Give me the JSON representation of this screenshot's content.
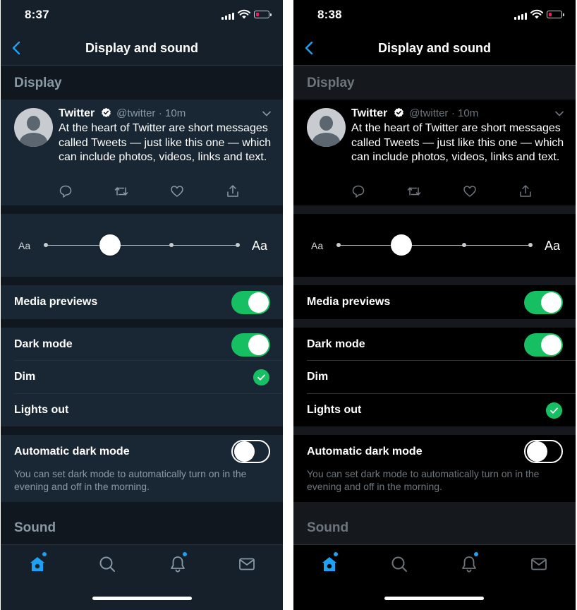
{
  "colors": {
    "accent": "#1da1f2",
    "toggle_on": "#17bf63",
    "dim_background": "#15202b",
    "lights_out_background": "#000000"
  },
  "screens": [
    {
      "theme": "dim",
      "status": {
        "time": "8:37"
      },
      "nav": {
        "title": "Display and sound",
        "back_icon": "chevron-left-icon"
      },
      "display_header": "Display",
      "tweet": {
        "name": "Twitter",
        "handle": "@twitter",
        "time": "· 10m",
        "text": "At the heart of Twitter are short messages called Tweets — just like this one — which can include photos, videos, links and text.",
        "actions": [
          "reply-icon",
          "retweet-icon",
          "like-icon",
          "share-icon"
        ]
      },
      "font_size": {
        "small_label": "Aa",
        "large_label": "Aa",
        "levels": 5,
        "selected_level": 2
      },
      "media_previews": {
        "label": "Media previews",
        "on": true
      },
      "dark_mode": {
        "label": "Dark mode",
        "on": true
      },
      "dim": {
        "label": "Dim",
        "checked": true
      },
      "lights_out": {
        "label": "Lights out",
        "checked": false
      },
      "auto_dark_mode": {
        "label": "Automatic dark mode",
        "on": false,
        "description": "You can set dark mode to automatically turn on in the evening and off in the morning."
      },
      "sound_header": "Sound",
      "tabs": [
        "home-icon",
        "search-icon",
        "notifications-icon",
        "messages-icon"
      ]
    },
    {
      "theme": "lights-out",
      "status": {
        "time": "8:38"
      },
      "nav": {
        "title": "Display and sound",
        "back_icon": "chevron-left-icon"
      },
      "display_header": "Display",
      "tweet": {
        "name": "Twitter",
        "handle": "@twitter",
        "time": "· 10m",
        "text": "At the heart of Twitter are short messages called Tweets — just like this one — which can include photos, videos, links and text.",
        "actions": [
          "reply-icon",
          "retweet-icon",
          "like-icon",
          "share-icon"
        ]
      },
      "font_size": {
        "small_label": "Aa",
        "large_label": "Aa",
        "levels": 5,
        "selected_level": 2
      },
      "media_previews": {
        "label": "Media previews",
        "on": true
      },
      "dark_mode": {
        "label": "Dark mode",
        "on": true
      },
      "dim": {
        "label": "Dim",
        "checked": false
      },
      "lights_out": {
        "label": "Lights out",
        "checked": true
      },
      "auto_dark_mode": {
        "label": "Automatic dark mode",
        "on": false,
        "description": "You can set dark mode to automatically turn on in the evening and off in the morning."
      },
      "sound_header": "Sound",
      "tabs": [
        "home-icon",
        "search-icon",
        "notifications-icon",
        "messages-icon"
      ]
    }
  ]
}
